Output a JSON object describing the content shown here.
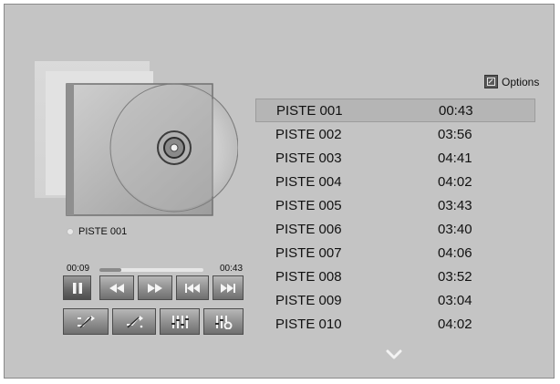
{
  "player": {
    "now_playing_title": "PISTE 001",
    "elapsed": "00:09",
    "total": "00:43",
    "progress_fraction": 0.21
  },
  "controls": {
    "row1": [
      "pause-icon",
      "rewind-icon",
      "fast-forward-icon",
      "skip-previous-icon",
      "skip-next-icon"
    ],
    "row2": [
      "shuffle-icon",
      "repeat-icon",
      "equalizer-icon",
      "equalizer-settings-icon"
    ]
  },
  "options": {
    "label": "Options",
    "icon": "options-icon"
  },
  "tracks": [
    {
      "title": "PISTE 001",
      "duration": "00:43",
      "selected": true
    },
    {
      "title": "PISTE 002",
      "duration": "03:56"
    },
    {
      "title": "PISTE 003",
      "duration": "04:41"
    },
    {
      "title": "PISTE 004",
      "duration": "04:02"
    },
    {
      "title": "PISTE 005",
      "duration": "03:43"
    },
    {
      "title": "PISTE 006",
      "duration": "03:40"
    },
    {
      "title": "PISTE 007",
      "duration": "04:06"
    },
    {
      "title": "PISTE 008",
      "duration": "03:52"
    },
    {
      "title": "PISTE 009",
      "duration": "03:04"
    },
    {
      "title": "PISTE 010",
      "duration": "04:02"
    }
  ],
  "scroll": {
    "icon": "chevron-down-icon"
  }
}
